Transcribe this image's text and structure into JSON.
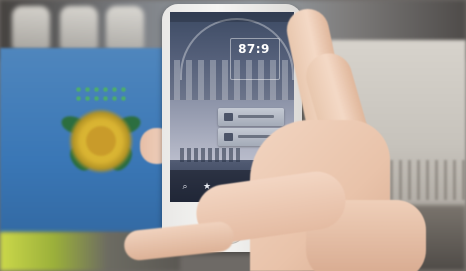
{
  "phone_screen": {
    "clock_time": "87:9",
    "clock_subtext": ""
  },
  "colors": {
    "poster_blue": "#3a77b6",
    "sun_yellow": "#d8b231",
    "skin": "#ecc9b3",
    "phone_body": "#f2f1ef"
  }
}
